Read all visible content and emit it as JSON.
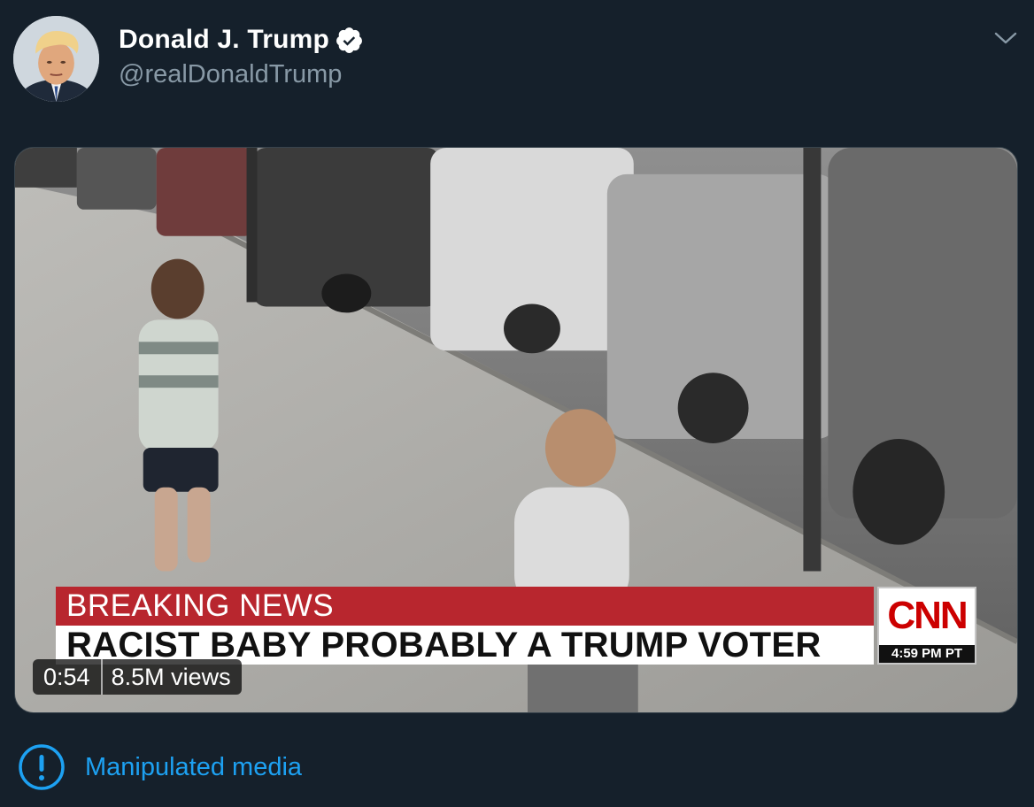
{
  "user": {
    "display_name": "Donald J. Trump",
    "handle": "@realDonaldTrump",
    "verified": true,
    "icons": {
      "verified": "verified-badge-icon",
      "menu": "chevron-down-icon"
    }
  },
  "media": {
    "chyron_top": "BREAKING NEWS",
    "chyron_bottom": "RACIST BABY PROBABLY A TRUMP VOTER",
    "network_logo": "CNN",
    "network_time": "4:59 PM PT",
    "duration": "0:54",
    "views": "8.5M views"
  },
  "notice": {
    "label": "Manipulated media",
    "icon": "exclamation-circle-icon"
  },
  "colors": {
    "background": "#15202b",
    "accent": "#1da1f2",
    "secondary_text": "#8899a6",
    "chyron_red": "#b8262e"
  }
}
